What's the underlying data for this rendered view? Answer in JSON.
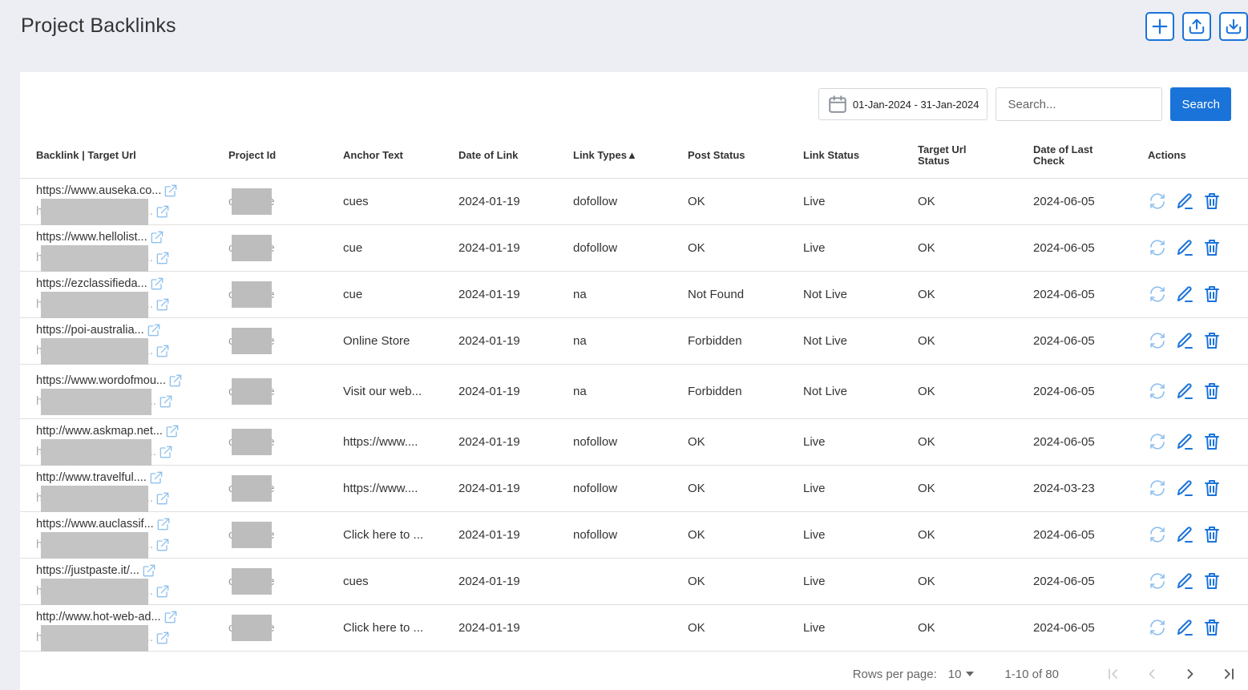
{
  "page": {
    "title": "Project Backlinks"
  },
  "top_actions": [
    {
      "name": "add-button",
      "icon": "plus-icon"
    },
    {
      "name": "upload-button",
      "icon": "upload-icon"
    },
    {
      "name": "download-button",
      "icon": "download-icon"
    }
  ],
  "toolbar": {
    "date_range": "01-Jan-2024 - 31-Jan-2024",
    "search_placeholder": "Search...",
    "search_value": "",
    "search_button": "Search"
  },
  "table": {
    "columns": [
      {
        "label": "Backlink | Target Url"
      },
      {
        "label": "Project Id"
      },
      {
        "label": "Anchor Text"
      },
      {
        "label": "Date of Link"
      },
      {
        "label": "Link Types",
        "sort": "▲"
      },
      {
        "label": "Post Status"
      },
      {
        "label": "Link Status"
      },
      {
        "label": "Target Url Status"
      },
      {
        "label": "Date of Last Check"
      },
      {
        "label": "Actions"
      }
    ],
    "rows": [
      {
        "backlink": "https://www.auseka.co...",
        "target_url": "https://www.cuestore...",
        "project_id": "cuestore",
        "anchor_text": "cues",
        "date_of_link": "2024-01-19",
        "link_type": "dofollow",
        "post_status": "OK",
        "link_status": "Live",
        "target_url_status": "OK",
        "last_check": "2024-06-05"
      },
      {
        "backlink": "https://www.hellolist...",
        "target_url": "https://www.cuestore...",
        "project_id": "cuestore",
        "anchor_text": "cue",
        "date_of_link": "2024-01-19",
        "link_type": "dofollow",
        "post_status": "OK",
        "link_status": "Live",
        "target_url_status": "OK",
        "last_check": "2024-06-05"
      },
      {
        "backlink": "https://ezclassifieda...",
        "target_url": "https://www.cuestore...",
        "project_id": "cuestore",
        "anchor_text": "cue",
        "date_of_link": "2024-01-19",
        "link_type": "na",
        "post_status": "Not Found",
        "link_status": "Not Live",
        "target_url_status": "OK",
        "last_check": "2024-06-05"
      },
      {
        "backlink": "https://poi-australia...",
        "target_url": "https://www.cuestore...",
        "project_id": "cuestore",
        "anchor_text": "Online Store",
        "date_of_link": "2024-01-19",
        "link_type": "na",
        "post_status": "Forbidden",
        "link_status": "Not Live",
        "target_url_status": "OK",
        "last_check": "2024-06-05"
      },
      {
        "backlink": "https://www.wordofmou...",
        "target_url": "https://www.cuestore....",
        "project_id": "cuestore",
        "anchor_text": "Visit our web...",
        "date_of_link": "2024-01-19",
        "link_type": "na",
        "post_status": "Forbidden",
        "link_status": "Not Live",
        "target_url_status": "OK",
        "last_check": "2024-06-05"
      },
      {
        "backlink": "http://www.askmap.net...",
        "target_url": "https://www.cuestore....",
        "project_id": "cuestore",
        "anchor_text": "https://www....",
        "date_of_link": "2024-01-19",
        "link_type": "nofollow",
        "post_status": "OK",
        "link_status": "Live",
        "target_url_status": "OK",
        "last_check": "2024-06-05"
      },
      {
        "backlink": "http://www.travelful....",
        "target_url": "https://www.cuestore...",
        "project_id": "cuestore",
        "anchor_text": "https://www....",
        "date_of_link": "2024-01-19",
        "link_type": "nofollow",
        "post_status": "OK",
        "link_status": "Live",
        "target_url_status": "OK",
        "last_check": "2024-03-23"
      },
      {
        "backlink": "https://www.auclassif...",
        "target_url": "https://www.cuestore...",
        "project_id": "cuestore",
        "anchor_text": "Click here to ...",
        "date_of_link": "2024-01-19",
        "link_type": "nofollow",
        "post_status": "OK",
        "link_status": "Live",
        "target_url_status": "OK",
        "last_check": "2024-06-05"
      },
      {
        "backlink": "https://justpaste.it/...",
        "target_url": "https://www.cuestore...",
        "project_id": "cuestore",
        "anchor_text": "cues",
        "date_of_link": "2024-01-19",
        "link_type": "",
        "post_status": "OK",
        "link_status": "Live",
        "target_url_status": "OK",
        "last_check": "2024-06-05"
      },
      {
        "backlink": "http://www.hot-web-ad...",
        "target_url": "https://www.cuestore...",
        "project_id": "cuestore",
        "anchor_text": "Click here to ...",
        "date_of_link": "2024-01-19",
        "link_type": "",
        "post_status": "OK",
        "link_status": "Live",
        "target_url_status": "OK",
        "last_check": "2024-06-05"
      }
    ],
    "row_actions": [
      {
        "name": "refresh-button",
        "icon": "refresh-icon"
      },
      {
        "name": "edit-button",
        "icon": "pencil-icon"
      },
      {
        "name": "delete-button",
        "icon": "trash-icon"
      }
    ]
  },
  "pagination": {
    "rows_per_page_label": "Rows per page:",
    "rows_per_page": "10",
    "range": "1-10 of 80"
  },
  "colors": {
    "primary": "#1a73d9",
    "icon_light": "#8ec0ee",
    "background": "#eceef4"
  }
}
